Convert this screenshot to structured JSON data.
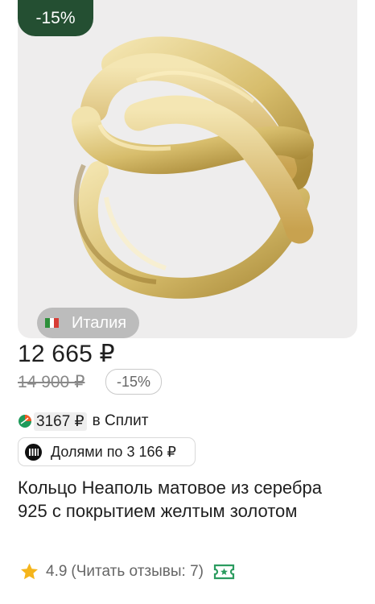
{
  "product": {
    "discount_badge": "-15%",
    "country": "Италия",
    "price": "12 665 ₽",
    "old_price": "14 900 ₽",
    "old_price_discount": "-15%",
    "split_amount": "3167 ₽",
    "split_label": "в Сплит",
    "installments": "Долями по 3 166 ₽",
    "title": "Кольцо Неаполь матовое из серебра 925 с покрытием желтым золотом",
    "rating": "4.9",
    "reviews": "(Читать отзывы: 7)",
    "icons": [
      "italy-flag-icon",
      "split-icon",
      "dolyami-icon",
      "star-icon",
      "ticket-icon"
    ],
    "colors": {
      "badge": "#244f32",
      "star": "#f5b51b",
      "accent": "#2b9b5f"
    }
  }
}
